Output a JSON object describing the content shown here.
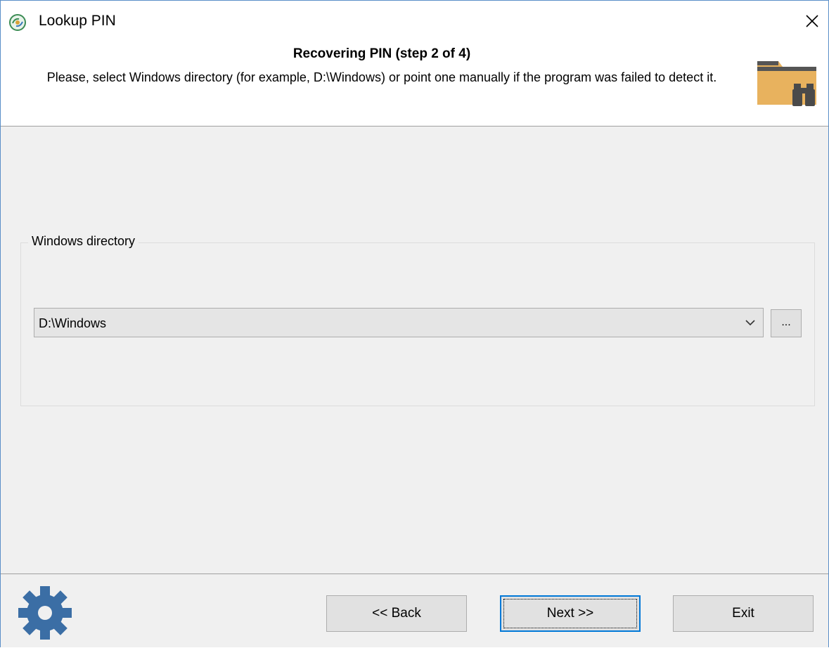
{
  "window": {
    "title": "Lookup PIN",
    "app_icon": "lookup-pin-app-icon",
    "close_icon": "close-icon"
  },
  "header": {
    "step_title": "Recovering PIN (step 2 of 4)",
    "description": "Please, select Windows directory (for example, D:\\Windows) or point one manually if the program was failed to detect it.",
    "icon": "folder-binoculars-icon"
  },
  "group": {
    "legend": "Windows directory",
    "combo_value": "D:\\Windows",
    "browse_label": "..."
  },
  "footer": {
    "gear_icon": "gear-icon",
    "back_label": "<< Back",
    "next_label": "Next >>",
    "exit_label": "Exit"
  },
  "colors": {
    "accent": "#0078d7",
    "gear": "#3b6ea5",
    "folder": "#e8b25e",
    "body_bg": "#f0f0f0"
  }
}
